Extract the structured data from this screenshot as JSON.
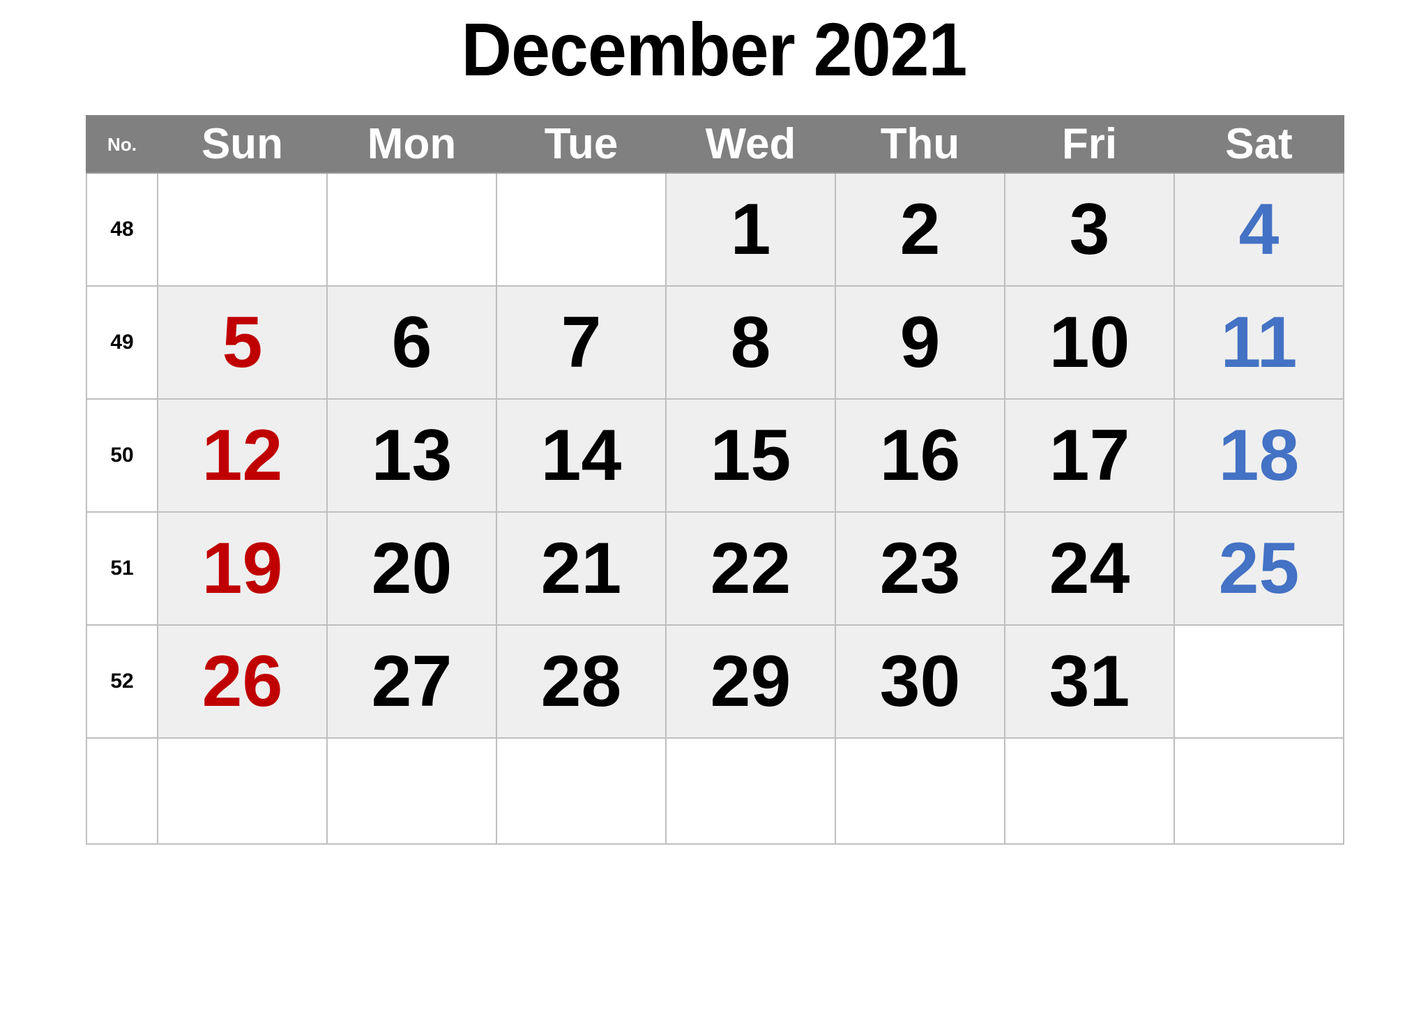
{
  "title": "December 2021",
  "colors": {
    "header_bg": "#808080",
    "header_text": "#ffffff",
    "cell_filled_bg": "#efefef",
    "cell_empty_bg": "#ffffff",
    "grid_line": "#bfbfbf",
    "weekday": "#000000",
    "sunday": "#c00000",
    "saturday": "#4472c4"
  },
  "header": {
    "weeknum_label": "No.",
    "days": [
      "Sun",
      "Mon",
      "Tue",
      "Wed",
      "Thu",
      "Fri",
      "Sat"
    ]
  },
  "weeks": [
    {
      "number": "48",
      "days": [
        {
          "label": "",
          "kind": "empty"
        },
        {
          "label": "",
          "kind": "empty"
        },
        {
          "label": "",
          "kind": "empty"
        },
        {
          "label": "1",
          "kind": "weekday"
        },
        {
          "label": "2",
          "kind": "weekday"
        },
        {
          "label": "3",
          "kind": "weekday"
        },
        {
          "label": "4",
          "kind": "saturday"
        }
      ]
    },
    {
      "number": "49",
      "days": [
        {
          "label": "5",
          "kind": "sunday"
        },
        {
          "label": "6",
          "kind": "weekday"
        },
        {
          "label": "7",
          "kind": "weekday"
        },
        {
          "label": "8",
          "kind": "weekday"
        },
        {
          "label": "9",
          "kind": "weekday"
        },
        {
          "label": "10",
          "kind": "weekday"
        },
        {
          "label": "11",
          "kind": "saturday"
        }
      ]
    },
    {
      "number": "50",
      "days": [
        {
          "label": "12",
          "kind": "sunday"
        },
        {
          "label": "13",
          "kind": "weekday"
        },
        {
          "label": "14",
          "kind": "weekday"
        },
        {
          "label": "15",
          "kind": "weekday"
        },
        {
          "label": "16",
          "kind": "weekday"
        },
        {
          "label": "17",
          "kind": "weekday"
        },
        {
          "label": "18",
          "kind": "saturday"
        }
      ]
    },
    {
      "number": "51",
      "days": [
        {
          "label": "19",
          "kind": "sunday"
        },
        {
          "label": "20",
          "kind": "weekday"
        },
        {
          "label": "21",
          "kind": "weekday"
        },
        {
          "label": "22",
          "kind": "weekday"
        },
        {
          "label": "23",
          "kind": "weekday"
        },
        {
          "label": "24",
          "kind": "weekday"
        },
        {
          "label": "25",
          "kind": "saturday"
        }
      ]
    },
    {
      "number": "52",
      "days": [
        {
          "label": "26",
          "kind": "sunday"
        },
        {
          "label": "27",
          "kind": "weekday"
        },
        {
          "label": "28",
          "kind": "weekday"
        },
        {
          "label": "29",
          "kind": "weekday"
        },
        {
          "label": "30",
          "kind": "weekday"
        },
        {
          "label": "31",
          "kind": "weekday"
        },
        {
          "label": "",
          "kind": "empty"
        }
      ]
    },
    {
      "number": "",
      "days": [
        {
          "label": "",
          "kind": "empty"
        },
        {
          "label": "",
          "kind": "empty"
        },
        {
          "label": "",
          "kind": "empty"
        },
        {
          "label": "",
          "kind": "empty"
        },
        {
          "label": "",
          "kind": "empty"
        },
        {
          "label": "",
          "kind": "empty"
        },
        {
          "label": "",
          "kind": "empty"
        }
      ]
    }
  ]
}
